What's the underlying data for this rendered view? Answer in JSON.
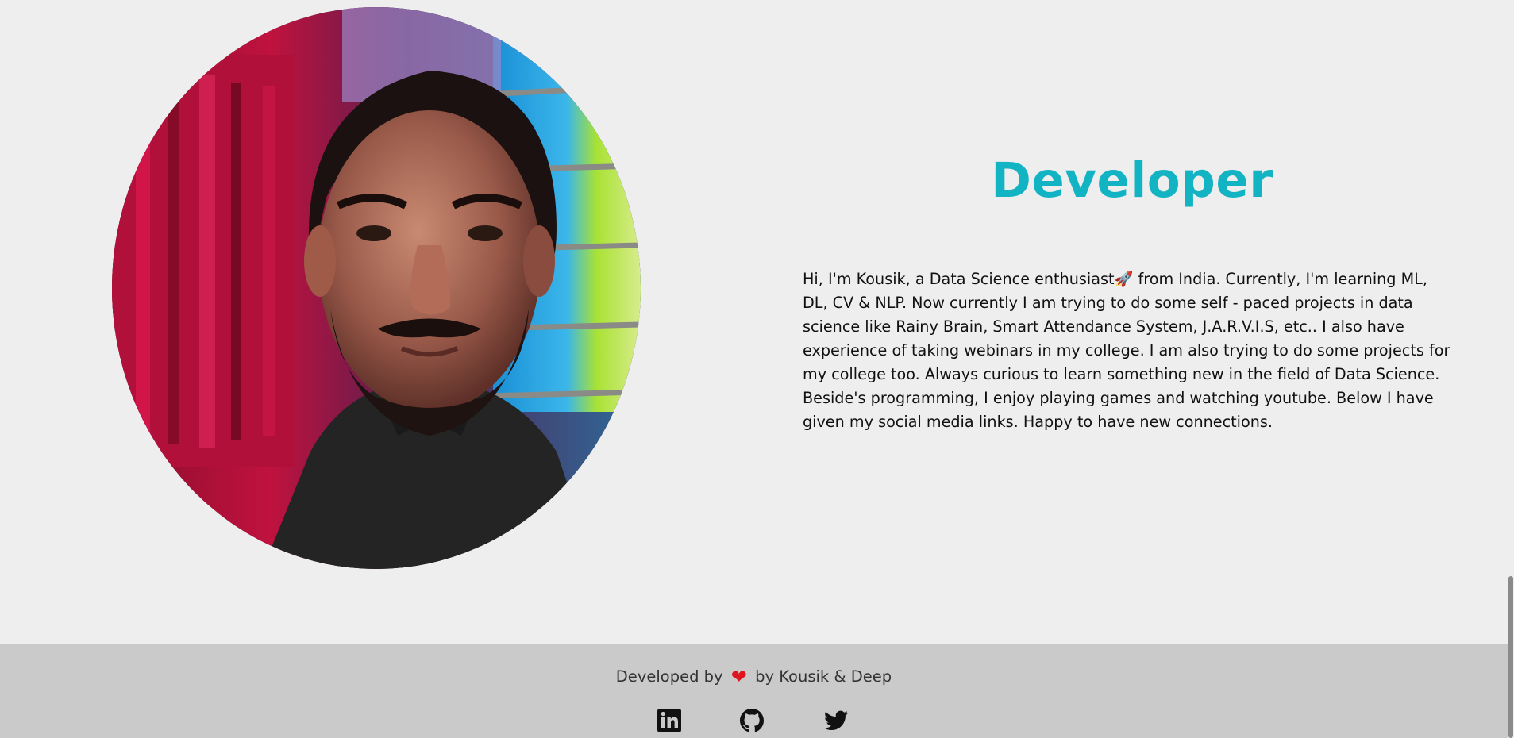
{
  "about": {
    "title": "Developer",
    "bio": "Hi, I'm Kousik, a Data Science enthusiast🚀 from India. Currently, I'm learning ML, DL, CV & NLP. Now currently I am trying to do some self - paced projects in data science like Rainy Brain, Smart Attendance System, J.A.R.V.I.S, etc.. I also have experience of taking webinars in my college. I am also trying to do some projects for my college too. Always curious to learn something new in the field of Data Science. Beside's programming, I enjoy playing games and watching youtube. Below I have given my social media links. Happy to have new connections.",
    "photo_icon": "developer-portrait"
  },
  "footer": {
    "developed_by": "Developed by",
    "heart_icon": "❤",
    "authors": "by Kousik & Deep",
    "social": [
      {
        "name": "linkedin",
        "icon": "linkedin-icon"
      },
      {
        "name": "github",
        "icon": "github-icon"
      },
      {
        "name": "twitter",
        "icon": "twitter-icon"
      }
    ]
  },
  "colors": {
    "accent": "#12b3c2",
    "background": "#eeeeee",
    "footer_bg": "#cacaca",
    "heart": "#e0141e"
  }
}
